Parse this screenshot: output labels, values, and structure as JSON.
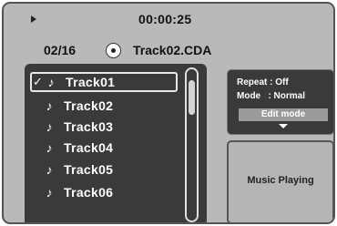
{
  "playback": {
    "time": "00:00:25"
  },
  "track_info": {
    "counter": "02/16",
    "filename": "Track02.CDA"
  },
  "playlist": {
    "items": [
      {
        "label": "Track01",
        "checked": true,
        "selected": true
      },
      {
        "label": "Track02",
        "checked": false,
        "selected": false
      },
      {
        "label": "Track03",
        "checked": false,
        "selected": false
      },
      {
        "label": "Track04",
        "checked": false,
        "selected": false
      },
      {
        "label": "Track05",
        "checked": false,
        "selected": false
      },
      {
        "label": "Track06",
        "checked": false,
        "selected": false
      }
    ],
    "check_glyph": "✓",
    "note_glyph": "♪"
  },
  "options": {
    "repeat": "Repeat : Off",
    "mode": "Mode   : Normal",
    "edit_mode_label": "Edit mode"
  },
  "status": {
    "text": "Music Playing"
  },
  "icons": [
    "play-icon",
    "disc-icon",
    "music-note-icon",
    "checkmark-icon",
    "down-arrow-icon"
  ]
}
